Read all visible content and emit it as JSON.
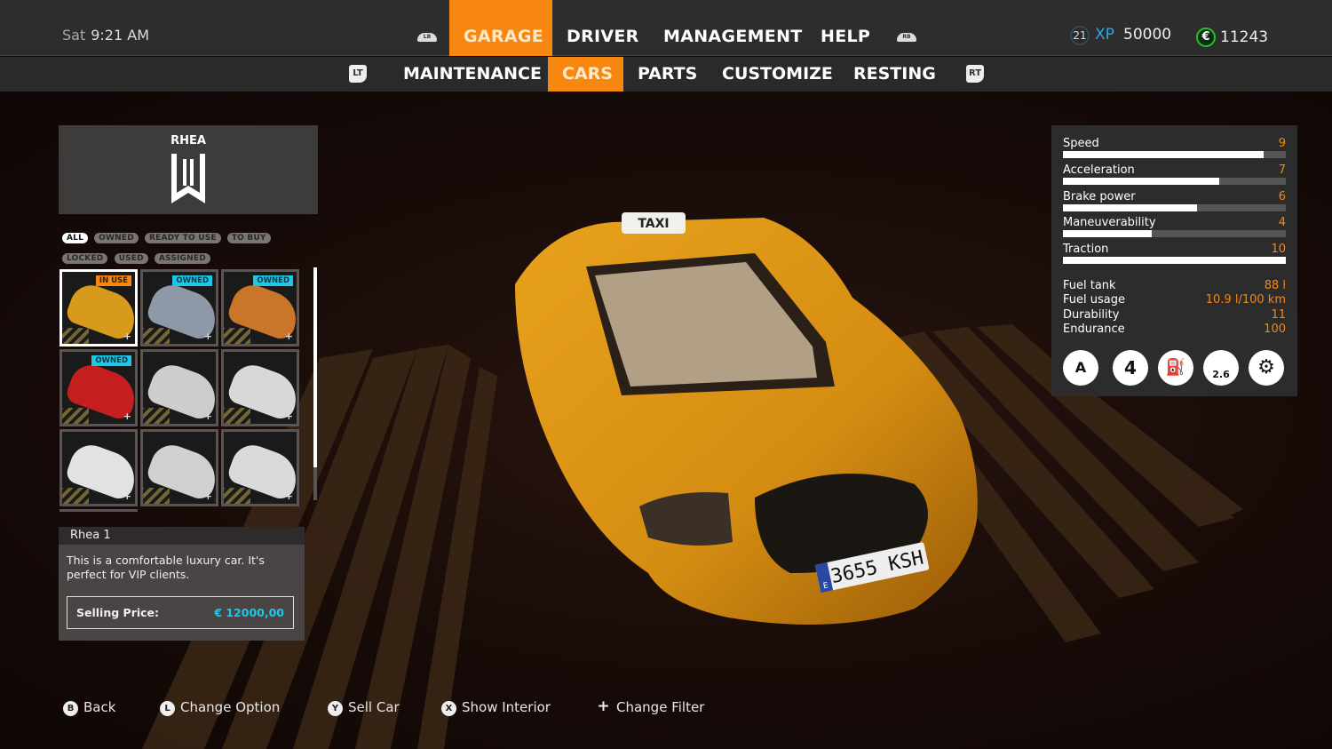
{
  "header": {
    "day": "Sat",
    "time": "9:21 AM",
    "left_bumper": "LB",
    "right_bumper": "RB",
    "nav_tabs": [
      {
        "label": "GARAGE",
        "active": true
      },
      {
        "label": "DRIVER",
        "active": false
      },
      {
        "label": "MANAGEMENT",
        "active": false
      },
      {
        "label": "HELP",
        "active": false
      }
    ],
    "player_level": "21",
    "xp_label": "XP",
    "xp_value": "50000",
    "currency_symbol": "€",
    "money": "11243"
  },
  "subnav": {
    "left_trigger": "LT",
    "right_trigger": "RT",
    "tabs": [
      {
        "label": "MAINTENANCE",
        "active": false
      },
      {
        "label": "CARS",
        "active": true
      },
      {
        "label": "PARTS",
        "active": false
      },
      {
        "label": "CUSTOMIZE",
        "active": false
      },
      {
        "label": "RESTING",
        "active": false
      }
    ]
  },
  "brand": {
    "name": "RHEA"
  },
  "filters": [
    "ALL",
    "OWNED",
    "READY TO USE",
    "TO BUY",
    "LOCKED",
    "USED",
    "ASSIGNED"
  ],
  "active_filter": "ALL",
  "cars": [
    {
      "badge": "IN USE",
      "color": "#d89a1c",
      "selected": true
    },
    {
      "badge": "OWNED",
      "color": "#8e99a8",
      "selected": false
    },
    {
      "badge": "OWNED",
      "color": "#c9752a",
      "selected": false
    },
    {
      "badge": "OWNED",
      "color": "#c41e1e",
      "selected": false
    },
    {
      "badge": "",
      "color": "#cfcccc",
      "selected": false
    },
    {
      "badge": "",
      "color": "#d8d8d8",
      "selected": false
    },
    {
      "badge": "",
      "color": "#e2e2e2",
      "selected": false
    },
    {
      "badge": "",
      "color": "#d0d0d0",
      "selected": false
    },
    {
      "badge": "",
      "color": "#dadada",
      "selected": false
    }
  ],
  "car_info": {
    "name": "Rhea 1",
    "description": "This is a comfortable luxury car. It's perfect for VIP clients.",
    "price_label": "Selling Price:",
    "price_value": "€ 12000,00"
  },
  "stats": [
    {
      "label": "Speed",
      "value": 9,
      "max": 10,
      "fill": 0.9
    },
    {
      "label": "Acceleration",
      "value": 7,
      "max": 10,
      "fill": 0.7
    },
    {
      "label": "Brake power",
      "value": 6,
      "max": 10,
      "fill": 0.6
    },
    {
      "label": "Maneuverability",
      "value": 4,
      "max": 10,
      "fill": 0.4
    },
    {
      "label": "Traction",
      "value": 10,
      "max": 10,
      "fill": 1.0
    }
  ],
  "specs": [
    {
      "label": "Fuel tank",
      "value": "88 l"
    },
    {
      "label": "Fuel usage",
      "value": "10.9 l/100 km"
    },
    {
      "label": "Durability",
      "value": "11"
    },
    {
      "label": "Endurance",
      "value": "100"
    }
  ],
  "features": [
    {
      "icon": "automatic-transmission-icon",
      "glyph": "A"
    },
    {
      "icon": "seats-icon",
      "glyph": "4"
    },
    {
      "icon": "fuel-type-icon",
      "glyph": "⛽"
    },
    {
      "icon": "weight-icon",
      "glyph": "2.6"
    },
    {
      "icon": "engine-icon",
      "glyph": "⚙"
    }
  ],
  "taxi": {
    "roof_sign": "TAXI",
    "plate": "3655 KSH",
    "plate_country": "E"
  },
  "hints": [
    {
      "button": "B",
      "label": "Back"
    },
    {
      "button": "L",
      "label": "Change Option"
    },
    {
      "button": "Y",
      "label": "Sell Car"
    },
    {
      "button": "X",
      "label": "Show Interior"
    },
    {
      "button": "+",
      "label": "Change Filter"
    }
  ],
  "colors": {
    "accent": "#f7870f",
    "owned_badge": "#1fc7e6",
    "xp": "#2fa6e0",
    "money_ring": "#22c42a"
  }
}
